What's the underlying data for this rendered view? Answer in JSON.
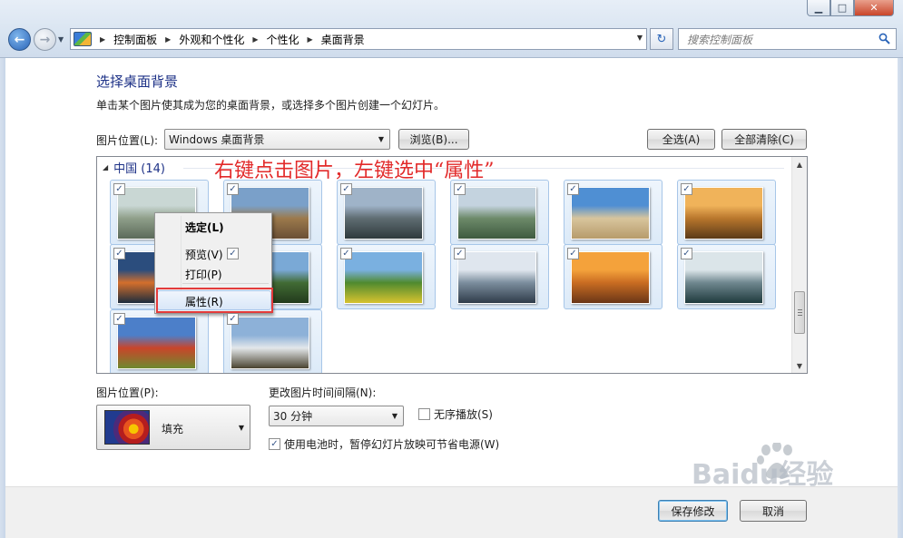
{
  "window": {
    "minimize_glyph": "▁",
    "maximize_glyph": "□",
    "close_glyph": "✕"
  },
  "nav": {
    "back_glyph": "←",
    "forward_glyph": "→",
    "dropdown_glyph": "▼"
  },
  "addressbar": {
    "crumbs": [
      "控制面板",
      "外观和个性化",
      "个性化",
      "桌面背景"
    ],
    "separator_glyph": "▶",
    "refresh_glyph": "↻"
  },
  "search": {
    "placeholder": "搜索控制面板"
  },
  "page": {
    "title": "选择桌面背景",
    "description": "单击某个图片使其成为您的桌面背景，或选择多个图片创建一个幻灯片。",
    "location_label": "图片位置(L):",
    "location_value": "Windows 桌面背景",
    "browse_label": "浏览(B)...",
    "select_all_label": "全选(A)",
    "clear_all_label": "全部清除(C)"
  },
  "picture_list": {
    "group_name": "中国 (14)",
    "check_glyph": "✓",
    "thumbnails": [
      {
        "name": "guilin-river",
        "checked": true,
        "colors": [
          "#c9d7d4",
          "#8f9f8a",
          "#5b6a5a"
        ]
      },
      {
        "name": "great-wall",
        "checked": true,
        "colors": [
          "#7aa0c9",
          "#9c7a4c",
          "#6a4f35"
        ]
      },
      {
        "name": "huangshan-peaks",
        "checked": true,
        "colors": [
          "#9fb3c8",
          "#5f6d72",
          "#2f3a3d"
        ]
      },
      {
        "name": "rice-terraces",
        "checked": true,
        "colors": [
          "#c4d3df",
          "#6d8a6a",
          "#3e5a3f"
        ]
      },
      {
        "name": "desert-dunes",
        "checked": true,
        "colors": [
          "#4f8fd3",
          "#d8c59d",
          "#b79b6b"
        ]
      },
      {
        "name": "seventeen-arch-bridge",
        "checked": true,
        "colors": [
          "#f0b35a",
          "#b9772d",
          "#5b3a18"
        ]
      },
      {
        "name": "river-sunset",
        "checked": true,
        "colors": [
          "#2b4d7d",
          "#d46f2c",
          "#1c2c3d"
        ]
      },
      {
        "name": "pagoda-hills",
        "checked": true,
        "colors": [
          "#7aa9d6",
          "#416b34",
          "#223a1c"
        ]
      },
      {
        "name": "rapeseed-fields",
        "checked": true,
        "colors": [
          "#7ab0e0",
          "#4f8a2f",
          "#d7c32f"
        ]
      },
      {
        "name": "winter-village",
        "checked": true,
        "colors": [
          "#dfe6ee",
          "#7b8d9d",
          "#2f3c4a"
        ]
      },
      {
        "name": "desert-sunset",
        "checked": true,
        "colors": [
          "#f4a23b",
          "#c96c22",
          "#6a3617"
        ]
      },
      {
        "name": "misty-mountains",
        "checked": true,
        "colors": [
          "#dbe5e9",
          "#6f878f",
          "#1f3a3d"
        ]
      },
      {
        "name": "flower-fields",
        "checked": true,
        "colors": [
          "#4c7fc9",
          "#c9452a",
          "#6e8a2e"
        ]
      },
      {
        "name": "sea-of-clouds",
        "checked": true,
        "colors": [
          "#8db1d8",
          "#e3e7ea",
          "#4a4330"
        ]
      }
    ]
  },
  "annotation": {
    "text": "右键点击图片，左键选中“属性”"
  },
  "context_menu": {
    "items": [
      "选定(L)",
      "预览(V)",
      "打印(P)",
      "属性(R)"
    ]
  },
  "lower": {
    "position_label": "图片位置(P):",
    "position_value": "填充",
    "interval_label": "更改图片时间间隔(N):",
    "interval_value": "30 分钟",
    "shuffle_label": "无序播放(S)",
    "shuffle_checked": false,
    "battery_label": "使用电池时，暂停幻灯片放映可节省电源(W)",
    "battery_checked": true
  },
  "footer": {
    "save_label": "保存修改",
    "cancel_label": "取消"
  },
  "watermark": {
    "text": "Baidu经验"
  },
  "colors": {
    "accent_blue": "#1e3287",
    "annotation_red": "#e22a2a"
  }
}
